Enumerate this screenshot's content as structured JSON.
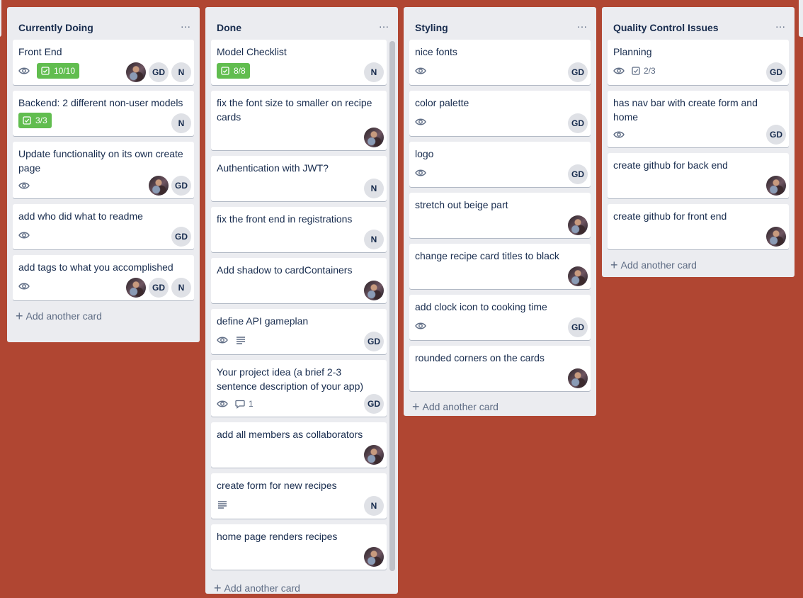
{
  "lists": {
    "currently_doing": {
      "title": "Currently Doing",
      "menu": "…",
      "add_label": "Add another card",
      "cards": [
        {
          "title": "Front End",
          "checklist": "10/10",
          "members": [
            "photo",
            "GD",
            "N"
          ]
        },
        {
          "title": "Backend: 2 different non-user models",
          "checklist": "3/3",
          "members": [
            "N"
          ]
        },
        {
          "title": "Update functionality on its own create page",
          "members": [
            "photo",
            "GD"
          ]
        },
        {
          "title": "add who did what to readme",
          "members": [
            "GD"
          ]
        },
        {
          "title": "add tags to what you accomplished",
          "members": [
            "photo",
            "GD",
            "N"
          ]
        }
      ]
    },
    "done": {
      "title": "Done",
      "menu": "…",
      "add_label": "Add another card",
      "cards": [
        {
          "title": "Model Checklist",
          "checklist": "8/8",
          "members": [
            "N"
          ]
        },
        {
          "title": "fix the font size to smaller on recipe cards",
          "members": [
            "photo"
          ]
        },
        {
          "title": "Authentication with JWT?",
          "members": [
            "N"
          ]
        },
        {
          "title": "fix the front end in registrations",
          "members": [
            "N"
          ]
        },
        {
          "title": "Add shadow to cardContainers",
          "members": [
            "photo"
          ]
        },
        {
          "title": "define API gameplan",
          "members": [
            "GD"
          ]
        },
        {
          "title": "Your project idea (a brief 2-3 sentence description of your app)",
          "comments": "1",
          "members": [
            "GD"
          ]
        },
        {
          "title": "add all members as collaborators",
          "members": [
            "photo"
          ]
        },
        {
          "title": "create form for new recipes",
          "members": [
            "N"
          ]
        },
        {
          "title": "home page renders recipes",
          "members": [
            "photo"
          ]
        }
      ]
    },
    "styling": {
      "title": "Styling",
      "menu": "…",
      "add_label": "Add another card",
      "cards": [
        {
          "title": "nice fonts",
          "members": [
            "GD"
          ]
        },
        {
          "title": "color palette",
          "members": [
            "GD"
          ]
        },
        {
          "title": "logo",
          "members": [
            "GD"
          ]
        },
        {
          "title": "stretch out beige part",
          "members": [
            "photo"
          ]
        },
        {
          "title": "change recipe card titles to black",
          "members": [
            "photo"
          ]
        },
        {
          "title": "add clock icon to cooking time",
          "members": [
            "GD"
          ]
        },
        {
          "title": "rounded corners on the cards",
          "members": [
            "photo"
          ]
        }
      ]
    },
    "qc": {
      "title": "Quality Control Issues",
      "menu": "…",
      "add_label": "Add another card",
      "cards": [
        {
          "title": "Planning",
          "checklist": "2/3",
          "members": [
            "GD"
          ]
        },
        {
          "title": "has nav bar with create form and home",
          "members": [
            "GD"
          ]
        },
        {
          "title": "create github for back end",
          "members": [
            "photo"
          ]
        },
        {
          "title": "create github for front end",
          "members": [
            "photo"
          ]
        }
      ]
    }
  },
  "colors": {
    "board_background": "#B04632",
    "list_background": "#EBECF0",
    "checklist_complete": "#61BD4F"
  },
  "icons": {
    "watch": "eye-icon",
    "checklist": "checkbox-icon",
    "description": "description-icon",
    "comment": "comment-icon",
    "add": "plus-icon",
    "menu": "ellipsis-icon"
  }
}
